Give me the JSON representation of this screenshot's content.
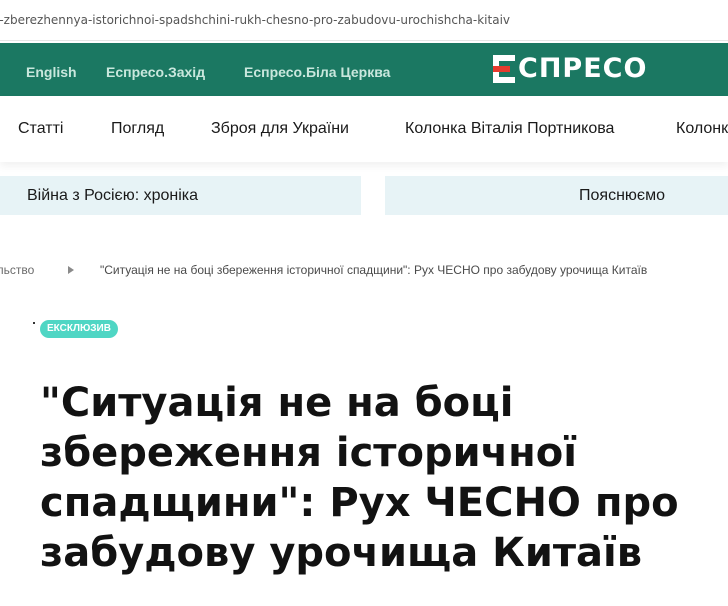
{
  "browser": {
    "url_fragment": "i-zberezhennya-istorichnoi-spadshchini-rukh-chesno-pro-zabudovu-urochishcha-kitaiv"
  },
  "topnav": {
    "links": [
      "English",
      "Еспресо.Захід",
      "Еспресо.Біла Церква"
    ],
    "logo_text": "СПРЕСО",
    "colors": {
      "background": "#1b7862",
      "link": "#c9e7dd",
      "logo_accent": "#e63b2e"
    }
  },
  "categories": [
    "Статті",
    "Погляд",
    "Зброя для України",
    "Колонка Віталія Портникова",
    "Колонк"
  ],
  "pills": [
    "Війна з Росією: хроніка",
    "Пояснюємо"
  ],
  "breadcrumb": {
    "parent": "ільство",
    "current": "\"Ситуація не на боці збереження історичної спадщини\": Рух ЧЕСНО про забудову урочища Китаїв"
  },
  "article": {
    "badge": "ЕКСКЛЮЗИВ",
    "title": "\"Ситуація не на боці збереження історичної спадщини\": Рух ЧЕСНО про забудову урочища Китаїв"
  }
}
